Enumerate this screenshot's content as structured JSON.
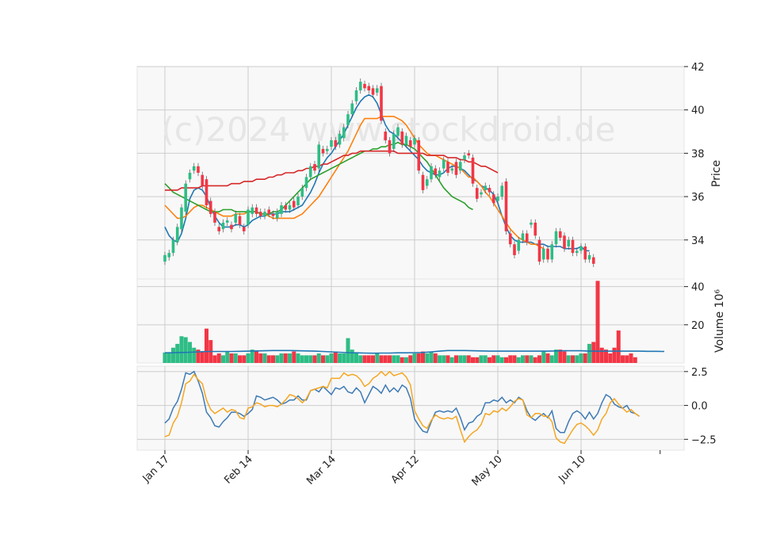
{
  "watermark": "(c)2024 www.stockdroid.de",
  "colors": {
    "up": "#2ebd85",
    "down": "#f23645",
    "ma_blue": "#1f77b4",
    "ma_orange": "#ff7f0e",
    "ma_green": "#2ca02c",
    "ma_red": "#d62728",
    "osc_blue": "#3e7ab5",
    "osc_orange": "#f5a623",
    "panel_bg": "#f8f8f8",
    "grid": "#cccccc"
  },
  "chart_data": [
    {
      "type": "candlestick",
      "panel": "price",
      "ylabel": "Price",
      "ylim": [
        32.2,
        42.0
      ],
      "yticks": [
        34,
        36,
        38,
        40,
        42
      ],
      "xticks": [
        "Jan 17",
        "Feb 14",
        "Mar 14",
        "Apr 12",
        "May 10",
        "Jun 10"
      ],
      "xtick_index": [
        0,
        20,
        40,
        60,
        80,
        100
      ],
      "grid": true,
      "candles": [
        [
          33.0,
          33.3
        ],
        [
          33.2,
          33.4
        ],
        [
          33.4,
          34.0
        ],
        [
          33.9,
          34.6
        ],
        [
          34.5,
          35.5
        ],
        [
          35.3,
          36.6
        ],
        [
          36.8,
          37.1
        ],
        [
          37.2,
          37.4
        ],
        [
          37.4,
          37.1
        ],
        [
          37.0,
          36.5
        ],
        [
          36.8,
          35.6
        ],
        [
          35.8,
          35.2
        ],
        [
          35.3,
          34.8
        ],
        [
          34.6,
          34.4
        ],
        [
          34.5,
          34.8
        ],
        [
          34.8,
          34.9
        ],
        [
          34.7,
          34.5
        ],
        [
          34.8,
          35.2
        ],
        [
          35.1,
          34.7
        ],
        [
          34.6,
          34.4
        ],
        [
          34.7,
          35.4
        ],
        [
          35.2,
          35.5
        ],
        [
          35.5,
          35.2
        ],
        [
          35.3,
          35.1
        ],
        [
          35.1,
          35.3
        ],
        [
          35.4,
          35.2
        ],
        [
          35.2,
          35.1
        ],
        [
          35.0,
          35.3
        ],
        [
          35.2,
          35.6
        ],
        [
          35.6,
          35.4
        ],
        [
          35.4,
          35.6
        ],
        [
          35.8,
          35.5
        ],
        [
          35.6,
          36.0
        ],
        [
          36.0,
          36.4
        ],
        [
          36.4,
          36.9
        ],
        [
          36.9,
          37.4
        ],
        [
          37.5,
          37.2
        ],
        [
          37.3,
          38.4
        ],
        [
          38.2,
          38.0
        ],
        [
          38.1,
          38.2
        ],
        [
          38.3,
          38.6
        ],
        [
          38.6,
          38.3
        ],
        [
          38.4,
          38.9
        ],
        [
          38.7,
          39.2
        ],
        [
          39.3,
          39.8
        ],
        [
          39.8,
          40.3
        ],
        [
          40.4,
          40.9
        ],
        [
          40.9,
          41.3
        ],
        [
          41.2,
          41.0
        ],
        [
          41.1,
          40.9
        ],
        [
          41.0,
          40.7
        ],
        [
          40.8,
          41.0
        ],
        [
          41.1,
          39.5
        ],
        [
          39.0,
          38.6
        ],
        [
          38.6,
          38.0
        ],
        [
          38.2,
          38.9
        ],
        [
          38.8,
          39.2
        ],
        [
          39.0,
          38.4
        ],
        [
          38.4,
          38.8
        ],
        [
          38.6,
          38.3
        ],
        [
          38.4,
          38.7
        ],
        [
          38.6,
          37.2
        ],
        [
          37.0,
          36.3
        ],
        [
          36.5,
          36.8
        ],
        [
          36.8,
          37.4
        ],
        [
          37.3,
          37.0
        ],
        [
          36.9,
          37.2
        ],
        [
          37.3,
          37.7
        ],
        [
          37.6,
          37.1
        ],
        [
          37.2,
          37.3
        ],
        [
          37.6,
          37.0
        ],
        [
          37.2,
          37.6
        ],
        [
          37.7,
          37.9
        ],
        [
          38.0,
          37.9
        ],
        [
          37.8,
          36.6
        ],
        [
          36.4,
          35.9
        ],
        [
          36.1,
          36.2
        ],
        [
          36.3,
          36.5
        ],
        [
          36.4,
          36.2
        ],
        [
          36.1,
          35.7
        ],
        [
          35.8,
          36.0
        ],
        [
          36.0,
          36.5
        ],
        [
          36.7,
          34.4
        ],
        [
          34.3,
          33.8
        ],
        [
          33.8,
          33.3
        ],
        [
          33.5,
          34.0
        ],
        [
          34.0,
          34.3
        ],
        [
          34.3,
          33.9
        ],
        [
          34.7,
          34.8
        ],
        [
          34.8,
          34.2
        ],
        [
          34.0,
          33.0
        ],
        [
          33.1,
          33.6
        ],
        [
          33.6,
          33.1
        ],
        [
          33.1,
          33.8
        ],
        [
          33.8,
          34.4
        ],
        [
          34.4,
          34.1
        ],
        [
          34.2,
          33.6
        ],
        [
          33.7,
          34.0
        ],
        [
          34.0,
          33.4
        ],
        [
          33.4,
          33.5
        ],
        [
          33.5,
          33.7
        ],
        [
          33.7,
          33.1
        ],
        [
          33.1,
          33.3
        ],
        [
          33.2,
          32.9
        ]
      ],
      "series": [
        {
          "name": "",
          "color_key": "ma_blue",
          "values": [
            34.6,
            34.2,
            34.0,
            33.9,
            34.3,
            35.0,
            35.9,
            36.3,
            36.4,
            36.3,
            36.0,
            35.5,
            35.1,
            34.8,
            34.6,
            34.6,
            34.6,
            34.7,
            34.7,
            34.6,
            34.7,
            34.9,
            35.0,
            35.1,
            35.1,
            35.2,
            35.2,
            35.2,
            35.3,
            35.3,
            35.3,
            35.4,
            35.5,
            35.6,
            35.9,
            36.2,
            36.6,
            37.1,
            37.5,
            37.8,
            38.0,
            38.3,
            38.6,
            38.9,
            39.3,
            39.7,
            40.1,
            40.4,
            40.6,
            40.7,
            40.6,
            40.3,
            39.8,
            39.3,
            39.0,
            38.9,
            38.7,
            38.5,
            38.3,
            38.1,
            37.9,
            37.7,
            37.4,
            37.2,
            37.1,
            37.0,
            37.0,
            37.1,
            37.3,
            37.4,
            37.4,
            37.3,
            37.2,
            37.0,
            36.8,
            36.7,
            36.5,
            36.4,
            36.3,
            36.1,
            35.7,
            35.1,
            34.6,
            34.2,
            34.0,
            33.9,
            33.9,
            33.9,
            33.9,
            33.8,
            33.8,
            33.8,
            33.7,
            33.7,
            33.7,
            33.7,
            33.6,
            33.6,
            33.6,
            33.6,
            33.7,
            33.5,
            33.5
          ]
        },
        {
          "name": "",
          "color_key": "ma_orange",
          "values": [
            35.6,
            35.4,
            35.2,
            35.0,
            35.0,
            35.1,
            35.3,
            35.5,
            35.6,
            35.6,
            35.5,
            35.4,
            35.3,
            35.2,
            35.1,
            35.1,
            35.1,
            35.2,
            35.2,
            35.2,
            35.3,
            35.3,
            35.3,
            35.2,
            35.2,
            35.1,
            35.0,
            35.0,
            35.0,
            35.0,
            35.0,
            35.0,
            35.1,
            35.2,
            35.4,
            35.6,
            35.8,
            36.0,
            36.3,
            36.6,
            36.9,
            37.2,
            37.5,
            37.8,
            38.1,
            38.5,
            38.9,
            39.3,
            39.6,
            39.6,
            39.6,
            39.6,
            39.7,
            39.7,
            39.7,
            39.7,
            39.6,
            39.5,
            39.3,
            39.0,
            38.7,
            38.4,
            38.2,
            38.0,
            37.9,
            37.9,
            37.8,
            37.7,
            37.6,
            37.5,
            37.4,
            37.3,
            37.1,
            36.9,
            36.9,
            36.7,
            36.5,
            36.2,
            36.0,
            35.7,
            35.4,
            35.1,
            34.8,
            34.5,
            34.3,
            34.1,
            34.0,
            33.9,
            33.8,
            33.8,
            33.7,
            33.6
          ]
        },
        {
          "name": "",
          "color_key": "ma_green",
          "values": [
            36.6,
            36.4,
            36.2,
            36.1,
            36.0,
            35.9,
            35.8,
            35.7,
            35.6,
            35.5,
            35.4,
            35.3,
            35.3,
            35.3,
            35.4,
            35.4,
            35.4,
            35.3,
            35.3,
            35.3,
            35.3,
            35.3,
            35.3,
            35.2,
            35.2,
            35.2,
            35.3,
            35.3,
            35.4,
            35.6,
            35.8,
            36.0,
            36.2,
            36.4,
            36.6,
            36.8,
            36.9,
            37.0,
            37.1,
            37.2,
            37.3,
            37.4,
            37.5,
            37.6,
            37.7,
            37.8,
            37.9,
            38.0,
            38.1,
            38.1,
            38.2,
            38.2,
            38.3,
            38.3,
            38.4,
            38.4,
            38.5,
            38.4,
            38.4,
            38.3,
            38.2,
            38.0,
            37.8,
            37.6,
            37.3,
            37.0,
            36.7,
            36.4,
            36.2,
            36.0,
            35.9,
            35.8,
            35.7,
            35.5,
            35.4
          ]
        },
        {
          "name": "",
          "color_key": "ma_red",
          "values": [
            36.3,
            36.3,
            36.3,
            36.3,
            36.4,
            36.4,
            36.4,
            36.4,
            36.4,
            36.5,
            36.5,
            36.5,
            36.5,
            36.5,
            36.5,
            36.5,
            36.6,
            36.6,
            36.6,
            36.7,
            36.7,
            36.7,
            36.8,
            36.8,
            36.8,
            36.9,
            36.9,
            37.0,
            37.0,
            37.1,
            37.1,
            37.1,
            37.2,
            37.2,
            37.3,
            37.3,
            37.4,
            37.4,
            37.5,
            37.5,
            37.6,
            37.7,
            37.8,
            37.9,
            37.9,
            38.0,
            38.0,
            38.1,
            38.1,
            38.1,
            38.1,
            38.1,
            38.1,
            38.1,
            38.1,
            38.1,
            38.0,
            38.0,
            38.0,
            38.0,
            38.0,
            38.0,
            38.0,
            37.9,
            37.9,
            37.9,
            37.9,
            37.9,
            37.8,
            37.8,
            37.8,
            37.7,
            37.7,
            37.6,
            37.6,
            37.5,
            37.4,
            37.4,
            37.3,
            37.2,
            37.1
          ]
        }
      ]
    },
    {
      "type": "bar",
      "panel": "volume",
      "ylabel": "Volume 10⁶",
      "ylim": [
        0,
        44
      ],
      "yticks": [
        20,
        40
      ],
      "grid": true,
      "values": [
        5.5,
        5.5,
        8,
        10,
        14,
        13.5,
        11,
        8,
        7,
        6,
        18,
        12,
        4,
        5,
        4,
        6,
        5,
        5,
        4,
        4,
        5,
        7,
        6,
        5,
        5,
        4,
        4,
        4,
        5,
        5,
        5,
        6,
        5,
        4,
        4,
        4,
        4,
        5,
        4,
        4,
        5,
        6,
        5,
        5,
        13,
        7,
        5,
        4,
        4,
        4,
        4,
        5,
        4,
        4,
        4,
        4,
        4,
        3,
        3,
        4,
        5,
        5,
        6,
        5,
        6,
        5,
        4,
        4,
        4,
        3,
        4,
        4,
        4,
        4,
        3,
        3,
        4,
        4,
        3,
        4,
        4,
        3,
        3,
        4,
        4,
        3,
        4,
        4,
        4,
        3,
        4,
        6,
        5,
        4,
        7,
        7,
        6,
        4,
        4,
        4,
        5,
        5,
        10,
        11,
        43,
        8,
        7,
        5,
        8,
        17,
        4,
        4,
        5,
        3
      ],
      "trend": [
        5.3,
        5.4,
        5.5,
        5.6,
        5.8,
        6.0,
        6.0,
        6.0,
        6.0,
        6.1,
        6.2,
        6.3,
        6.4,
        6.5,
        6.5,
        6.5,
        6.4,
        6.3,
        6.2,
        6.0,
        5.8,
        5.6,
        5.4,
        5.3,
        5.2,
        5.1,
        5.2,
        5.2,
        5.3,
        5.3,
        5.4,
        5.5,
        5.8,
        6.2,
        6.5,
        6.5,
        6.5,
        6.4,
        6.3,
        6.2,
        6.2,
        6.2,
        6.2,
        6.2,
        6.2,
        6.2,
        6.2,
        6.3,
        6.4,
        6.4,
        6.4,
        6.2,
        6.2,
        6.2,
        6.2,
        6.2,
        6.2,
        6.2,
        6.1,
        6.1,
        6.0
      ]
    },
    {
      "type": "line",
      "panel": "oscillator",
      "ylim": [
        -3.3,
        2.9
      ],
      "yticks": [
        -2.5,
        0.0,
        2.5
      ],
      "grid": true,
      "series": [
        {
          "name": "",
          "color_key": "osc_blue",
          "values": [
            -1.3,
            -1.0,
            -0.2,
            0.3,
            1.2,
            2.4,
            2.3,
            2.5,
            1.8,
            0.9,
            -0.5,
            -0.9,
            -1.5,
            -1.6,
            -1.2,
            -0.9,
            -0.5,
            -0.5,
            -0.6,
            -0.8,
            -0.6,
            -0.3,
            0.7,
            0.6,
            0.4,
            0.5,
            0.6,
            0.4,
            0.1,
            0.2,
            0.4,
            0.4,
            0.7,
            0.4,
            0.4,
            1.1,
            1.2,
            1.0,
            1.4,
            1.1,
            0.8,
            1.3,
            1.2,
            1.4,
            1.0,
            0.9,
            1.3,
            1.0,
            0.2,
            0.8,
            1.4,
            1.2,
            0.9,
            1.5,
            1.0,
            1.3,
            1.0,
            1.5,
            1.3,
            0.5,
            -1.0,
            -1.5,
            -1.9,
            -2.0,
            -1.2,
            -0.5,
            -0.4,
            -0.5,
            -0.4,
            -0.5,
            -0.2,
            -0.9,
            -1.8,
            -1.3,
            -1.2,
            -0.8,
            -0.6,
            0.2,
            0.2,
            0.4,
            0.3,
            0.6,
            0.2,
            0.4,
            0.2,
            0.6,
            0.4,
            -0.4,
            -0.9,
            -1.1,
            -0.8,
            -0.6,
            -0.9,
            -0.4,
            -1.7,
            -2.0,
            -2.0,
            -1.2,
            -0.6,
            -0.4,
            -0.6,
            -1.0,
            -0.5,
            -1.0,
            -0.6,
            0.2,
            0.8,
            0.6,
            0.1,
            -0.1,
            -0.2,
            0.0,
            -0.5,
            -0.6,
            -0.8
          ]
        },
        {
          "name": "",
          "color_key": "osc_orange",
          "values": [
            -2.3,
            -2.2,
            -1.3,
            -0.8,
            0.2,
            1.6,
            1.8,
            2.3,
            1.9,
            1.6,
            0.4,
            -0.3,
            -0.6,
            -0.4,
            -0.2,
            -0.5,
            -0.3,
            -0.4,
            -0.9,
            -1.0,
            -0.2,
            -0.1,
            0.2,
            0.1,
            -0.1,
            0.0,
            0.0,
            -0.1,
            0.1,
            0.4,
            0.8,
            0.7,
            0.5,
            0.2,
            0.5,
            1.1,
            1.2,
            1.3,
            1.4,
            1.3,
            2.0,
            2.0,
            2.0,
            2.4,
            2.2,
            2.3,
            2.2,
            1.9,
            1.4,
            1.6,
            2.0,
            2.2,
            2.5,
            2.2,
            2.5,
            2.2,
            2.3,
            2.4,
            2.1,
            1.5,
            -0.4,
            -1.0,
            -1.5,
            -1.7,
            -1.1,
            -0.7,
            -0.9,
            -1.0,
            -0.9,
            -1.0,
            -0.8,
            -1.8,
            -2.7,
            -2.3,
            -2.0,
            -1.8,
            -1.4,
            -0.6,
            -0.7,
            -0.4,
            -0.5,
            -0.2,
            -0.4,
            -0.1,
            0.3,
            0.5,
            0.4,
            -0.7,
            -0.9,
            -0.6,
            -0.6,
            -0.8,
            -0.8,
            -1.2,
            -2.4,
            -2.7,
            -2.8,
            -2.3,
            -1.8,
            -1.4,
            -1.3,
            -1.5,
            -1.8,
            -2.2,
            -1.8,
            -1.0,
            -0.6,
            0.2,
            0.5,
            0.1,
            -0.2,
            -0.5,
            -0.3,
            -0.6,
            -0.8
          ]
        }
      ]
    }
  ]
}
